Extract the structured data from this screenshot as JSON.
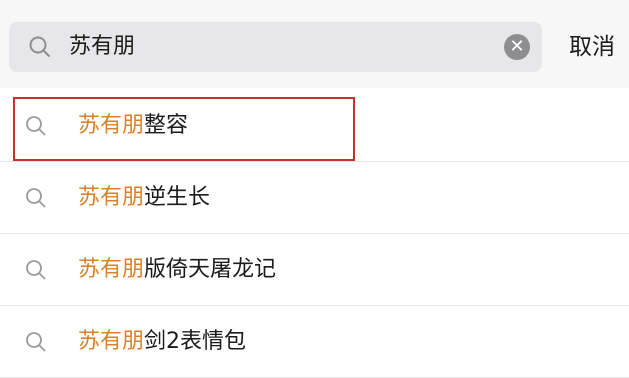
{
  "search": {
    "query": "苏有朋",
    "icon": "search-icon",
    "clear_icon": "clear-icon",
    "clear_glyph": "✕"
  },
  "cancel_label": "取消",
  "suggestions": [
    {
      "highlight": "苏有朋",
      "rest": "整容",
      "icon": "search-icon"
    },
    {
      "highlight": "苏有朋",
      "rest": "逆生长",
      "icon": "search-icon"
    },
    {
      "highlight": "苏有朋",
      "rest": "版倚天屠龙记",
      "icon": "search-icon"
    },
    {
      "highlight": "苏有朋",
      "rest": "剑2表情包",
      "icon": "search-icon"
    }
  ],
  "colors": {
    "highlight_text": "#d9822b",
    "annotation_box": "#c8312c",
    "search_background": "#e7e7e9"
  }
}
